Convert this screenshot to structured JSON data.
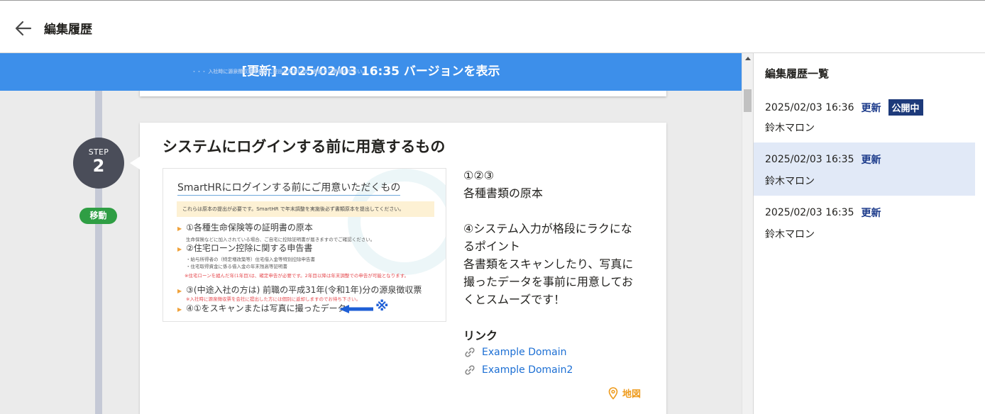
{
  "header": {
    "title": "編集履歴",
    "back_icon": "arrow-left-icon"
  },
  "banner": {
    "text": "[更新] 2025/02/03 16:35 バージョンを表示",
    "faint_text": "・・・ 入社時に源泉徴収票を会社に提出した方には、各自でご準備ください。",
    "color": "#3d8fea"
  },
  "step": {
    "label": "STEP",
    "number": "2",
    "move_label": "移動"
  },
  "card": {
    "title": "システムにログインする前に用意するもの",
    "slide": {
      "title": "SmartHRにログインする前にご用意いただくもの",
      "note": "これらは原本の提出が必要です。SmartHR で年末調整を実施後必ず書類原本を提出してください。",
      "items": [
        "①各種生命保険等の証明書の原本",
        "②住宅ローン控除に関する申告書",
        "③(中途入社の方は) 前職の平成31年(令和1年)分の源泉徴収票",
        "④①をスキャンまたは写真に撮ったデータ"
      ],
      "subs": [
        "生命保険などに加入されている場合、ご自宅に控除証明書が届きますのでご確認ください。",
        "・給与所得者の（特定増改築等）住宅借入金等特別控除申告書",
        "・住宅取得資金に係る借入金の年末残高等証明書",
        "※住宅ローンを組んだ年(1年目)は、確定申告が必要です。2年目以降は年末調整での申告が可能となります。",
        "※入社時に源泉徴収票を会社に提出した方には個別に返却しますのでお待ち下さい。"
      ],
      "kome": "※"
    },
    "description": [
      "①②③",
      "各種書類の原本",
      "",
      "④システム入力が格段にラクにな",
      "るポイント",
      "各書類をスキャンしたり、写真に",
      "撮ったデータを事前に用意してお",
      "くとスムーズです！"
    ],
    "links_heading": "リンク",
    "links": [
      {
        "label": "Example Domain",
        "icon": "link-icon"
      },
      {
        "label": "Example Domain2",
        "icon": "link-icon"
      }
    ],
    "map_label": "地図",
    "map_icon": "map-pin-icon"
  },
  "history": {
    "title": "編集履歴一覧",
    "items": [
      {
        "datetime": "2025/02/03 16:36",
        "type": "更新",
        "badge": "公開中",
        "author": "鈴木マロン",
        "selected": false
      },
      {
        "datetime": "2025/02/03 16:35",
        "type": "更新",
        "badge": "",
        "author": "鈴木マロン",
        "selected": true
      },
      {
        "datetime": "2025/02/03 16:35",
        "type": "更新",
        "badge": "",
        "author": "鈴木マロン",
        "selected": false
      }
    ]
  }
}
